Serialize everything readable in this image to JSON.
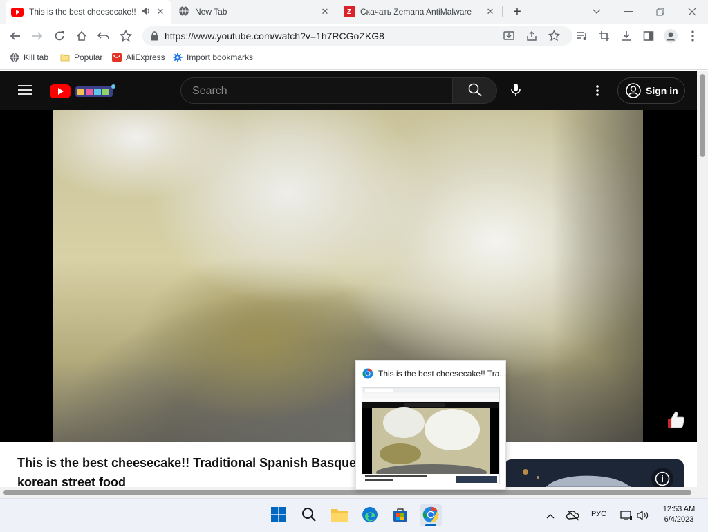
{
  "tabs": [
    {
      "title": "This is the best cheesecake!! Traditional Spanish Basque Cheesecake",
      "favicon": "youtube-icon",
      "audio": true,
      "active": true
    },
    {
      "title": "New Tab",
      "favicon": "globe-icon",
      "active": false
    },
    {
      "title": "Скачать Zemana AntiMalware",
      "favicon": "zemana-icon",
      "active": false
    }
  ],
  "new_tab_symbol": "+",
  "omnibox": {
    "url": "https://www.youtube.com/watch?v=1h7RCGoZKG8"
  },
  "bookmarks": [
    {
      "label": "Kill tab",
      "icon": "globe-icon"
    },
    {
      "label": "Popular",
      "icon": "folder-icon"
    },
    {
      "label": "AliExpress",
      "icon": "aliexpress-icon"
    },
    {
      "label": "Import bookmarks",
      "icon": "gear-icon"
    }
  ],
  "youtube": {
    "search_placeholder": "Search",
    "signin_label": "Sign in",
    "video_title_line1": "This is the best cheesecake!! Traditional Spanish Basque Cl",
    "video_title_line2": "korean street food"
  },
  "preview": {
    "title": "This is the best cheesecake!! Tra..."
  },
  "taskbar": {
    "lang": "РУС",
    "time": "12:53 AM",
    "date": "6/4/2023"
  },
  "colors": {
    "youtube_red": "#ff0000",
    "yt_dark": "#0f0f0f",
    "taskbar": "#eef1f7",
    "windows_blue": "#0067c0"
  }
}
